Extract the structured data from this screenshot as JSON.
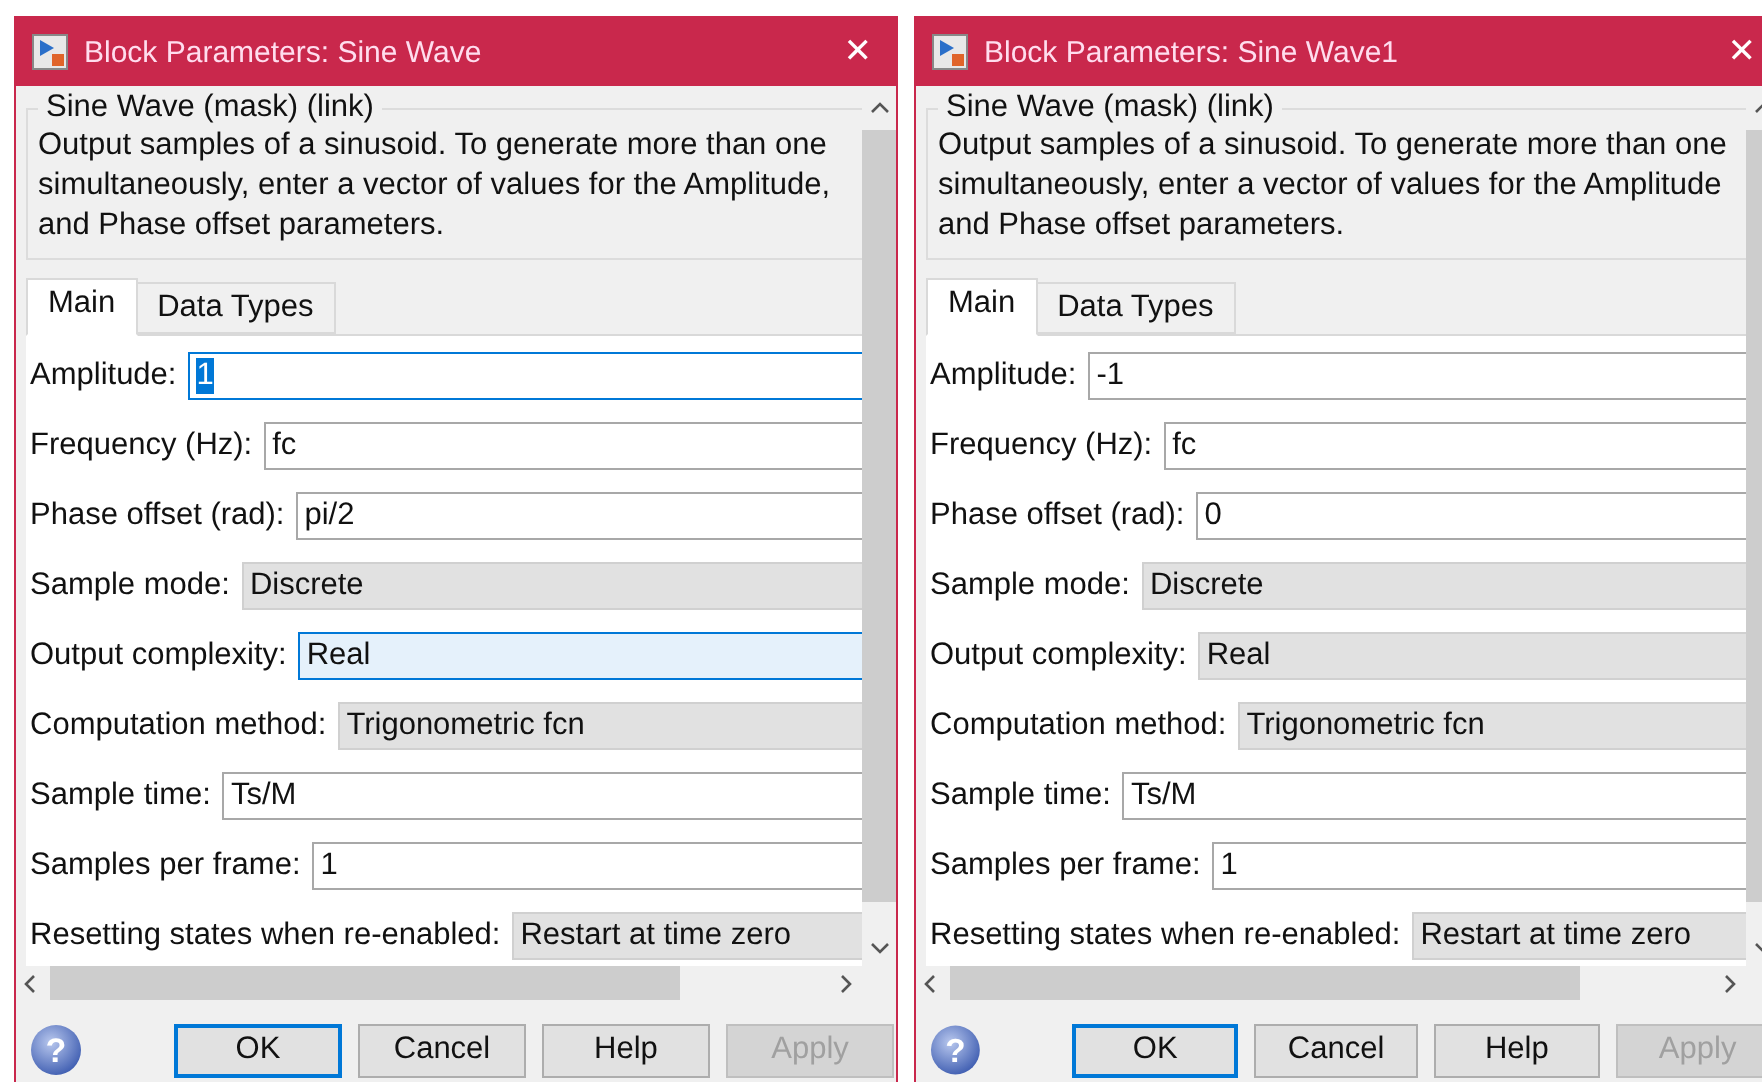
{
  "dialogs": [
    {
      "title": "Block Parameters: Sine Wave",
      "close": "✕",
      "group_title": "Sine Wave (mask) (link)",
      "description": [
        "Output samples of a sinusoid.  To generate more than one",
        "simultaneously, enter a vector of values for the Amplitude,",
        "and Phase offset parameters."
      ],
      "tabs": [
        {
          "label": "Main",
          "selected": true
        },
        {
          "label": "Data Types",
          "selected": false
        }
      ],
      "params": [
        {
          "label": "Amplitude:",
          "kind": "edit",
          "value": "1",
          "focused": true,
          "hovered": false
        },
        {
          "label": "Frequency (Hz):",
          "kind": "edit",
          "value": "fc",
          "focused": false,
          "hovered": false
        },
        {
          "label": "Phase offset (rad):",
          "kind": "edit",
          "value": "pi/2",
          "focused": false,
          "hovered": false
        },
        {
          "label": "Sample mode:",
          "kind": "combo",
          "value": "Discrete",
          "focused": false,
          "hovered": false
        },
        {
          "label": "Output complexity:",
          "kind": "combo",
          "value": "Real",
          "focused": false,
          "hovered": true
        },
        {
          "label": "Computation method:",
          "kind": "combo",
          "value": "Trigonometric fcn",
          "focused": false,
          "hovered": false
        },
        {
          "label": "Sample time:",
          "kind": "edit",
          "value": "Ts/M",
          "focused": false,
          "hovered": false
        },
        {
          "label": "Samples per frame:",
          "kind": "edit",
          "value": "1",
          "focused": false,
          "hovered": false
        },
        {
          "label": "Resetting states when re-enabled:",
          "kind": "combo",
          "value": "Restart at time zero",
          "focused": false,
          "hovered": false
        }
      ],
      "help": "?",
      "buttons": [
        {
          "label": "OK",
          "default": true,
          "disabled": false
        },
        {
          "label": "Cancel",
          "default": false,
          "disabled": false
        },
        {
          "label": "Help",
          "default": false,
          "disabled": false
        },
        {
          "label": "Apply",
          "default": false,
          "disabled": true
        }
      ]
    },
    {
      "title": "Block Parameters: Sine Wave1",
      "close": "✕",
      "group_title": "Sine Wave (mask) (link)",
      "description": [
        "Output samples of a sinusoid.  To generate more than one",
        "simultaneously, enter a vector of values for the Amplitude",
        "and Phase offset parameters."
      ],
      "tabs": [
        {
          "label": "Main",
          "selected": true
        },
        {
          "label": "Data Types",
          "selected": false
        }
      ],
      "params": [
        {
          "label": "Amplitude:",
          "kind": "edit",
          "value": "-1",
          "focused": false,
          "hovered": false
        },
        {
          "label": "Frequency (Hz):",
          "kind": "edit",
          "value": "fc",
          "focused": false,
          "hovered": false
        },
        {
          "label": "Phase offset (rad):",
          "kind": "edit",
          "value": "0",
          "focused": false,
          "hovered": false
        },
        {
          "label": "Sample mode:",
          "kind": "combo",
          "value": "Discrete",
          "focused": false,
          "hovered": false
        },
        {
          "label": "Output complexity:",
          "kind": "combo",
          "value": "Real",
          "focused": false,
          "hovered": false
        },
        {
          "label": "Computation method:",
          "kind": "combo",
          "value": "Trigonometric fcn",
          "focused": false,
          "hovered": false
        },
        {
          "label": "Sample time:",
          "kind": "edit",
          "value": "Ts/M",
          "focused": false,
          "hovered": false
        },
        {
          "label": "Samples per frame:",
          "kind": "edit",
          "value": "1",
          "focused": false,
          "hovered": false
        },
        {
          "label": "Resetting states when re-enabled:",
          "kind": "combo",
          "value": "Restart at time zero",
          "focused": false,
          "hovered": false
        }
      ],
      "help": "?",
      "buttons": [
        {
          "label": "OK",
          "default": true,
          "disabled": false
        },
        {
          "label": "Cancel",
          "default": false,
          "disabled": false
        },
        {
          "label": "Help",
          "default": false,
          "disabled": false
        },
        {
          "label": "Apply",
          "default": false,
          "disabled": true
        }
      ]
    }
  ]
}
